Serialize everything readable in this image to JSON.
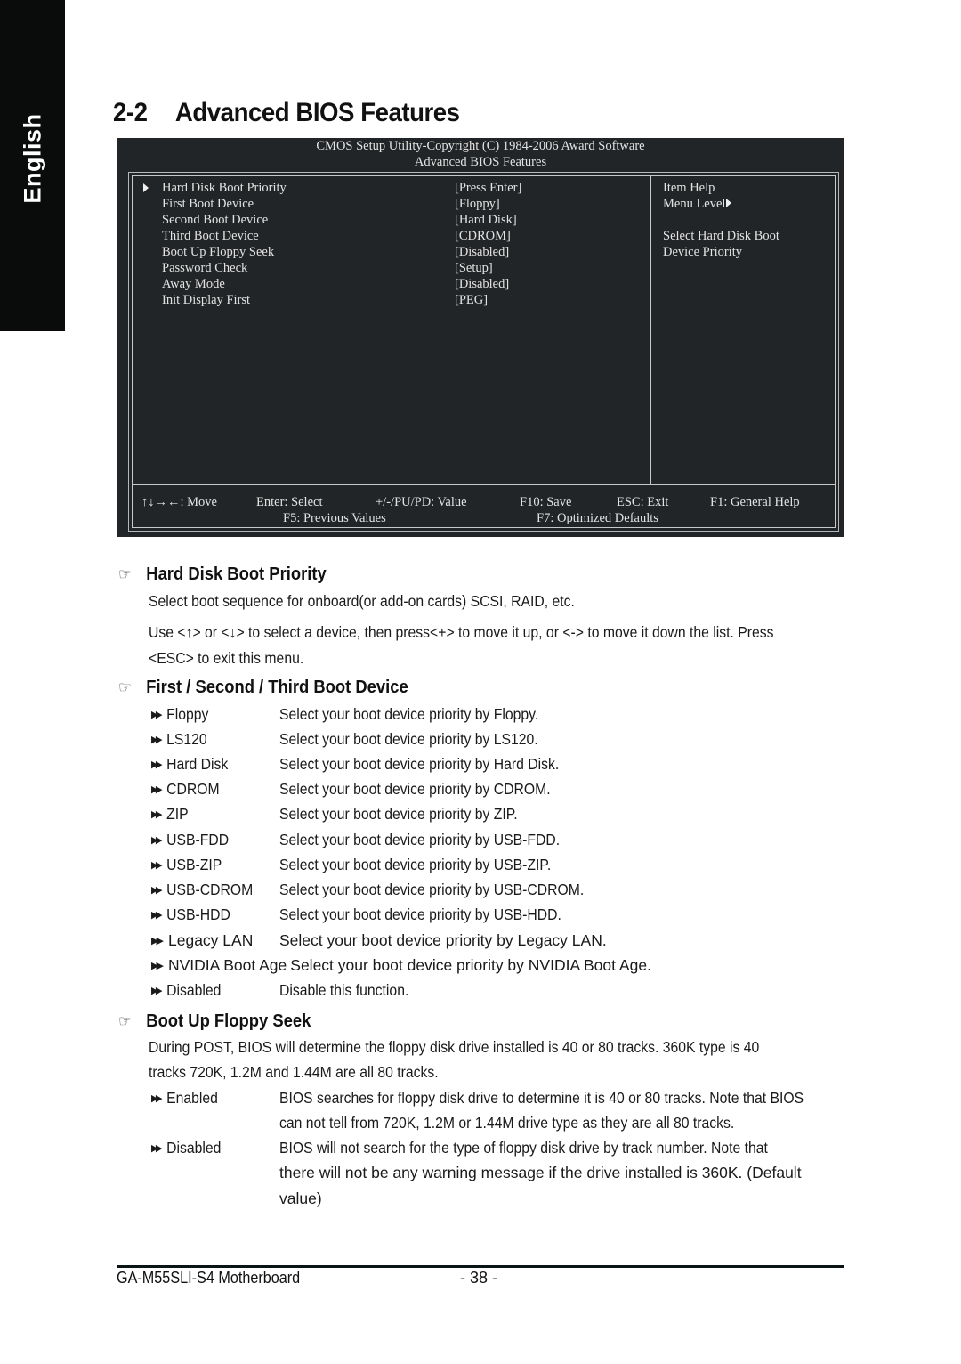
{
  "side_tab": {
    "label": "English"
  },
  "section": {
    "number": "2-2",
    "title": "Advanced BIOS Features"
  },
  "bios": {
    "header_line1": "CMOS Setup Utility-Copyright (C) 1984-2006 Award Software",
    "header_line2": "Advanced BIOS Features",
    "items": [
      {
        "label": "Hard Disk Boot Priority",
        "value": "[Press Enter]",
        "submenu": true
      },
      {
        "label": "First Boot Device",
        "value": "[Floppy]"
      },
      {
        "label": "Second Boot Device",
        "value": "[Hard Disk]"
      },
      {
        "label": "Third Boot Device",
        "value": "[CDROM]"
      },
      {
        "label": "Boot Up Floppy Seek",
        "value": "[Disabled]"
      },
      {
        "label": "Password Check",
        "value": "[Setup]"
      },
      {
        "label": "Away Mode",
        "value": "[Disabled]"
      },
      {
        "label": "Init Display First",
        "value": "[PEG]"
      }
    ],
    "help": {
      "title": "Item Help",
      "menu_level": "Menu Level",
      "line1": "Select Hard Disk Boot",
      "line2": "Device Priority"
    },
    "footer": {
      "move": "↑↓→←: Move",
      "select": "Enter: Select",
      "value": "+/-/PU/PD: Value",
      "save": "F10: Save",
      "exit": "ESC: Exit",
      "help": "F1: General Help",
      "previous": "F5: Previous Values",
      "optimized": "F7: Optimized Defaults"
    }
  },
  "doc": {
    "hand_icon": "☞",
    "bullet_icon": "▶▶",
    "hdbp": {
      "title": "Hard Disk Boot Priority",
      "p1": "Select boot sequence for onboard(or add-on cards) SCSI, RAID, etc.",
      "p2": "Use <↑> or <↓> to select a device, then press<+> to move it up, or <-> to move it down the list. Press",
      "p3": "<ESC> to exit this menu."
    },
    "boot_device": {
      "title": "First / Second / Third Boot Device",
      "options": [
        {
          "name": "Floppy",
          "desc": "Select your boot device priority by Floppy."
        },
        {
          "name": "LS120",
          "desc": "Select your boot device priority by LS120."
        },
        {
          "name": "Hard Disk",
          "desc": "Select your boot device priority by Hard Disk."
        },
        {
          "name": "CDROM",
          "desc": "Select your boot device priority by CDROM."
        },
        {
          "name": "ZIP",
          "desc": "Select your boot device priority by ZIP."
        },
        {
          "name": "USB-FDD",
          "desc": "Select your boot device priority by USB-FDD."
        },
        {
          "name": "USB-ZIP",
          "desc": "Select your boot device priority by USB-ZIP."
        },
        {
          "name": "USB-CDROM",
          "desc": "Select your boot device priority by USB-CDROM."
        },
        {
          "name": "USB-HDD",
          "desc": "Select your boot device priority by USB-HDD."
        },
        {
          "name": "Legacy LAN",
          "desc": "Select your boot device priority by Legacy LAN."
        },
        {
          "name": "NVIDIA Boot Age",
          "desc": "Select your boot device priority by NVIDIA Boot Age."
        },
        {
          "name": "Disabled",
          "desc": "Disable this function."
        }
      ]
    },
    "floppy_seek": {
      "title": "Boot Up Floppy Seek",
      "p1": "During POST, BIOS will determine the floppy disk drive installed is 40 or 80 tracks. 360K type is 40",
      "p2": "tracks 720K, 1.2M and 1.44M are all 80 tracks.",
      "options": [
        {
          "name": "Enabled",
          "desc1": "BIOS searches for floppy disk drive to determine it is 40 or 80 tracks. Note that BIOS",
          "desc2": "can not tell from 720K, 1.2M or 1.44M drive type as they are all 80 tracks."
        },
        {
          "name": "Disabled",
          "desc1": "BIOS will not search for the type of floppy disk drive by track number. Note that",
          "desc2": "there will not be any warning message if the drive installed is 360K. (Default",
          "desc3": "value)"
        }
      ]
    }
  },
  "footer": {
    "product": "GA-M55SLI-S4 Motherboard",
    "page": "- 38 -"
  }
}
